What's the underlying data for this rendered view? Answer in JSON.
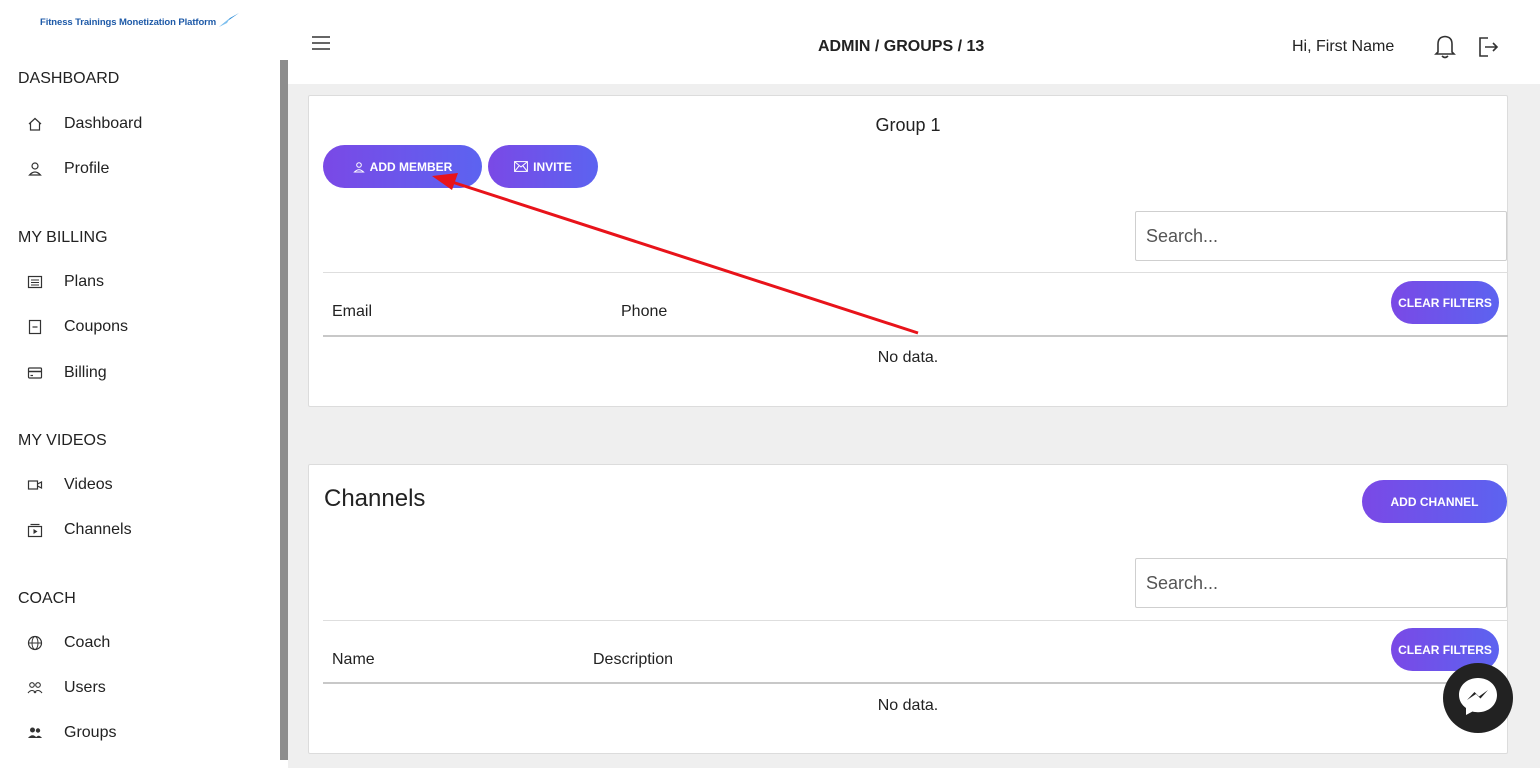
{
  "logo": {
    "text": "Fitness Trainings Monetization Platform"
  },
  "sidebar": {
    "sections": [
      {
        "title": "DASHBOARD",
        "items": [
          {
            "label": "Dashboard",
            "icon": "home-icon"
          },
          {
            "label": "Profile",
            "icon": "user-icon"
          }
        ]
      },
      {
        "title": "MY BILLING",
        "items": [
          {
            "label": "Plans",
            "icon": "list-icon"
          },
          {
            "label": "Coupons",
            "icon": "coupon-icon"
          },
          {
            "label": "Billing",
            "icon": "card-icon"
          }
        ]
      },
      {
        "title": "MY VIDEOS",
        "items": [
          {
            "label": "Videos",
            "icon": "video-icon"
          },
          {
            "label": "Channels",
            "icon": "channel-icon"
          }
        ]
      },
      {
        "title": "COACH",
        "items": [
          {
            "label": "Coach",
            "icon": "globe-icon"
          },
          {
            "label": "Users",
            "icon": "users-icon"
          },
          {
            "label": "Groups",
            "icon": "groups-icon"
          }
        ]
      }
    ]
  },
  "header": {
    "breadcrumb": "ADMIN / GROUPS / 13",
    "greeting": "Hi, First Name"
  },
  "group_card": {
    "title": "Group 1",
    "add_member_label": "ADD MEMBER",
    "invite_label": "INVITE",
    "search_placeholder": "Search...",
    "clear_filters_label": "CLEAR FILTERS",
    "columns": [
      "Email",
      "Phone"
    ],
    "empty_text": "No data."
  },
  "channels_card": {
    "title": "Channels",
    "add_channel_label": "ADD CHANNEL",
    "search_placeholder": "Search...",
    "clear_filters_label": "CLEAR FILTERS",
    "columns": [
      "Name",
      "Description"
    ],
    "empty_text": "No data."
  },
  "colors": {
    "accent_start": "#7a49e6",
    "accent_end": "#5c63f0",
    "annotation_arrow": "#e8131a"
  }
}
